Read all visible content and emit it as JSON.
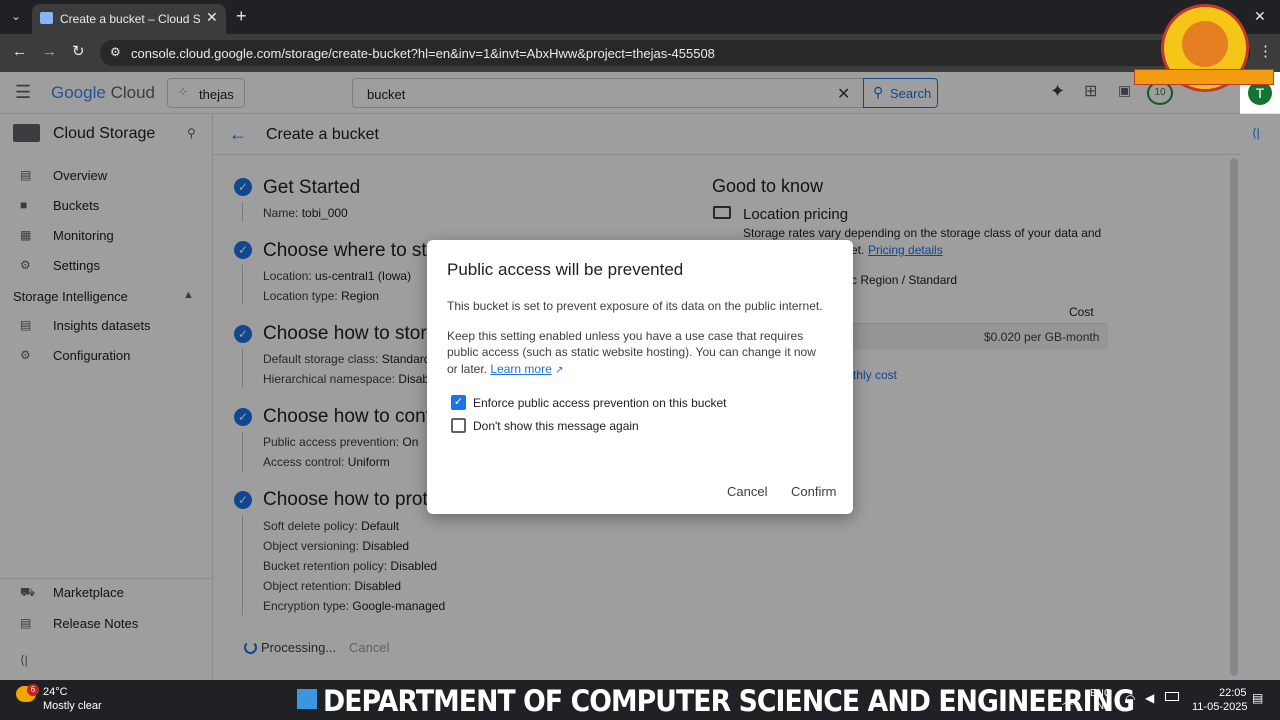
{
  "browser": {
    "tab_title": "Create a bucket – Cloud Storag",
    "url": "console.cloud.google.com/storage/create-bucket?hl=en&inv=1&invt=AbxHww&project=thejas-455508"
  },
  "header": {
    "logo_google": "Google",
    "logo_cloud": "Cloud",
    "project": "thejas",
    "search_value": "bucket",
    "search_label": "Search",
    "notif_count": "10",
    "avatar_letter": "T"
  },
  "sidebar": {
    "title": "Cloud Storage",
    "items": [
      {
        "label": "Overview",
        "icon": "overview-icon"
      },
      {
        "label": "Buckets",
        "icon": "bucket-icon"
      },
      {
        "label": "Monitoring",
        "icon": "monitoring-icon"
      },
      {
        "label": "Settings",
        "icon": "settings-icon"
      }
    ],
    "section": "Storage Intelligence",
    "section_items": [
      {
        "label": "Insights datasets",
        "icon": "dataset-icon"
      },
      {
        "label": "Configuration",
        "icon": "gear-icon"
      }
    ],
    "bottom_items": [
      {
        "label": "Marketplace",
        "icon": "cart-icon"
      },
      {
        "label": "Release Notes",
        "icon": "notes-icon"
      }
    ]
  },
  "page": {
    "title": "Create a bucket",
    "steps": [
      {
        "title": "Get Started",
        "rows": [
          [
            "Name: ",
            "tobi_000"
          ]
        ]
      },
      {
        "title": "Choose where to store your data",
        "rows": [
          [
            "Location: ",
            "us-central1 (Iowa)"
          ],
          [
            "Location type: ",
            "Region"
          ]
        ]
      },
      {
        "title": "Choose how to store your data",
        "rows": [
          [
            "Default storage class: ",
            "Standard"
          ],
          [
            "Hierarchical namespace: ",
            "Disabled"
          ]
        ]
      },
      {
        "title": "Choose how to control access to objects",
        "rows": [
          [
            "Public access prevention: ",
            "On"
          ],
          [
            "Access control: ",
            "Uniform"
          ]
        ]
      },
      {
        "title": "Choose how to protect object data",
        "rows": [
          [
            "Soft delete policy: ",
            "Default"
          ],
          [
            "Object versioning: ",
            "Disabled"
          ],
          [
            "Bucket retention policy: ",
            "Disabled"
          ],
          [
            "Object retention: ",
            "Disabled"
          ],
          [
            "Encryption type: ",
            "Google-managed"
          ]
        ]
      }
    ],
    "processing": "Processing...",
    "cancel": "Cancel"
  },
  "good_to_know": {
    "title": "Good to know",
    "subtitle": "Location pricing",
    "text": "Storage rates vary depending on the storage class of your data and",
    "text2": "et.",
    "pricing_link": "Pricing details",
    "region_line": "c Region / Standard",
    "cost_header": "Cost",
    "cost_value": "$0.020 per GB-month",
    "monthly": "thly cost"
  },
  "dialog": {
    "title": "Public access will be prevented",
    "p1": "This bucket is set to prevent exposure of its data on the public internet.",
    "p2_l1": "Keep this setting enabled unless you have a use case that requires",
    "p2_l2": "public access (such as static website hosting). You can change it now",
    "p2_l3": "or later.",
    "learn_more": "Learn more",
    "cb1": "Enforce public access prevention on this bucket",
    "cb2": "Don't show this message again",
    "cancel": "Cancel",
    "confirm": "Confirm"
  },
  "taskbar": {
    "weather_temp": "24°C",
    "weather_desc": "Mostly clear",
    "weather_badge": "6",
    "banner": "DEPARTMENT OF COMPUTER SCIENCE AND ENGINEERING",
    "lang1": "ENG",
    "lang2": "IN",
    "time": "22:05",
    "date": "11-05-2025"
  }
}
